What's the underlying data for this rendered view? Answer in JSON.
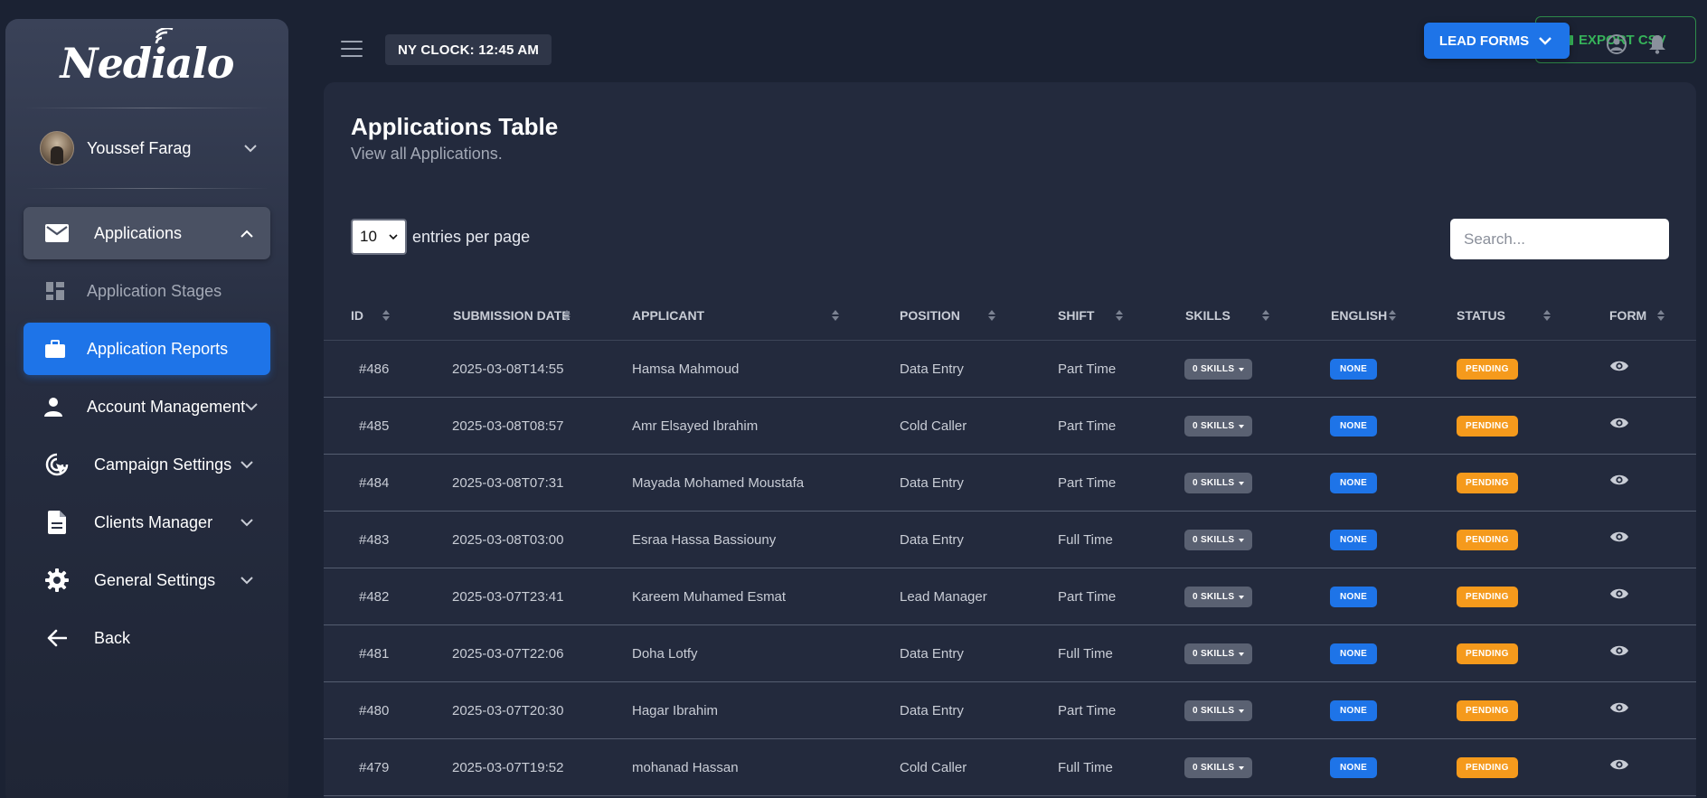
{
  "brand": {
    "name": "Nedialo"
  },
  "user": {
    "name": "Youssef Farag"
  },
  "sidebar": {
    "items": [
      {
        "label": "Applications",
        "icon": "envelope-icon",
        "expanded": true
      },
      {
        "label": "Application Stages",
        "icon": "dashboard-icon"
      },
      {
        "label": "Application Reports",
        "icon": "briefcase-icon",
        "active": true
      },
      {
        "label": "Account Management",
        "icon": "person-icon"
      },
      {
        "label": "Campaign Settings",
        "icon": "target-cursor-icon"
      },
      {
        "label": "Clients Manager",
        "icon": "document-icon"
      },
      {
        "label": "General Settings",
        "icon": "gear-icon"
      },
      {
        "label": "Back",
        "icon": "arrow-left-icon"
      }
    ]
  },
  "topbar": {
    "clock": "NY CLOCK: 12:45 AM",
    "lead_forms": "LEAD FORMS",
    "export_csv": "EXPORT CSV"
  },
  "main": {
    "title": "Applications Table",
    "subtitle": "View all Applications.",
    "entries_value": "10",
    "entries_label": "entries per page",
    "search_placeholder": "Search...",
    "columns": [
      "ID",
      "SUBMISSION DATE",
      "APPLICANT",
      "POSITION",
      "SHIFT",
      "SKILLS",
      "ENGLISH",
      "STATUS",
      "FORM"
    ],
    "rows": [
      {
        "id": "#486",
        "date": "2025-03-08T14:55",
        "applicant": "Hamsa Mahmoud",
        "position": "Data Entry",
        "shift": "Part Time",
        "skills": "0 SKILLS",
        "english": "NONE",
        "status": "PENDING"
      },
      {
        "id": "#485",
        "date": "2025-03-08T08:57",
        "applicant": "Amr Elsayed Ibrahim",
        "position": "Cold Caller",
        "shift": "Part Time",
        "skills": "0 SKILLS",
        "english": "NONE",
        "status": "PENDING"
      },
      {
        "id": "#484",
        "date": "2025-03-08T07:31",
        "applicant": "Mayada Mohamed Moustafa",
        "position": "Data Entry",
        "shift": "Part Time",
        "skills": "0 SKILLS",
        "english": "NONE",
        "status": "PENDING"
      },
      {
        "id": "#483",
        "date": "2025-03-08T03:00",
        "applicant": "Esraa Hassa Bassiouny",
        "position": "Data Entry",
        "shift": "Full Time",
        "skills": "0 SKILLS",
        "english": "NONE",
        "status": "PENDING"
      },
      {
        "id": "#482",
        "date": "2025-03-07T23:41",
        "applicant": "Kareem Muhamed Esmat",
        "position": "Lead Manager",
        "shift": "Part Time",
        "skills": "0 SKILLS",
        "english": "NONE",
        "status": "PENDING"
      },
      {
        "id": "#481",
        "date": "2025-03-07T22:06",
        "applicant": "Doha Lotfy",
        "position": "Data Entry",
        "shift": "Full Time",
        "skills": "0 SKILLS",
        "english": "NONE",
        "status": "PENDING"
      },
      {
        "id": "#480",
        "date": "2025-03-07T20:30",
        "applicant": "Hagar Ibrahim",
        "position": "Data Entry",
        "shift": "Part Time",
        "skills": "0 SKILLS",
        "english": "NONE",
        "status": "PENDING"
      },
      {
        "id": "#479",
        "date": "2025-03-07T19:52",
        "applicant": "mohanad Hassan",
        "position": "Cold Caller",
        "shift": "Full Time",
        "skills": "0 SKILLS",
        "english": "NONE",
        "status": "PENDING"
      }
    ]
  },
  "colors": {
    "accent": "#1e74e8",
    "pending": "#f59a1c",
    "skills_badge": "#5a6172",
    "export_green": "#36b35a",
    "background": "#1b2233",
    "card": "#232a3d"
  }
}
